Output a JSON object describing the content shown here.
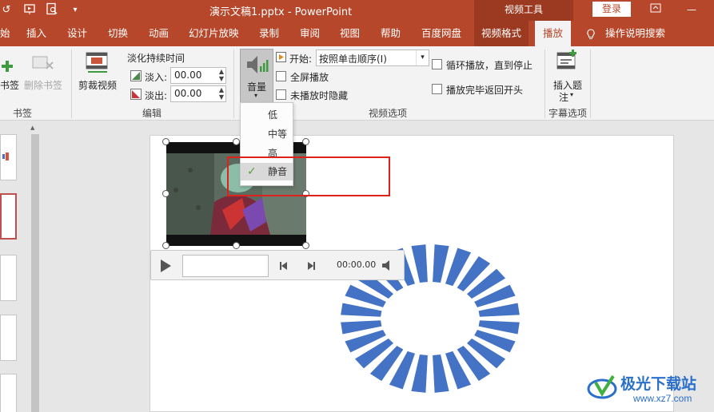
{
  "titlebar": {
    "title": "演示文稿1.pptx  -  PowerPoint",
    "context_tool": "视频工具",
    "login": "登录"
  },
  "tabs": [
    {
      "label": "始"
    },
    {
      "label": "插入"
    },
    {
      "label": "设计"
    },
    {
      "label": "切换"
    },
    {
      "label": "动画"
    },
    {
      "label": "幻灯片放映"
    },
    {
      "label": "录制"
    },
    {
      "label": "审阅"
    },
    {
      "label": "视图"
    },
    {
      "label": "帮助"
    },
    {
      "label": "百度网盘"
    },
    {
      "label": "视频格式"
    },
    {
      "label": "播放"
    }
  ],
  "tell_me": "操作说明搜索",
  "ribbon": {
    "bookmark": {
      "add": "书签",
      "remove": "删除书签",
      "group": "书签"
    },
    "edit": {
      "trim": "剪裁视频",
      "fade_title": "淡化持续时间",
      "fade_in_label": "淡入:",
      "fade_in_value": "00.00",
      "fade_out_label": "淡出:",
      "fade_out_value": "00.00",
      "group": "编辑"
    },
    "video_options": {
      "volume": "音量",
      "start_label": "开始:",
      "start_value": "按照单击顺序(I)",
      "fullscreen": "全屏播放",
      "hide_not_playing": "未播放时隐藏",
      "loop": "循环播放，直到停止",
      "rewind": "播放完毕返回开头",
      "group": "视频选项"
    },
    "captions": {
      "insert_line1": "插入题",
      "insert_line2": "注",
      "group": "字幕选项"
    }
  },
  "volume_menu": {
    "items": [
      {
        "label": "低"
      },
      {
        "label": "中等"
      },
      {
        "label": "高"
      },
      {
        "label": "静音"
      }
    ],
    "selected": "静音"
  },
  "player": {
    "time": "00:00.00"
  },
  "watermark": {
    "text": "极光下载站",
    "url": "www.xz7.com"
  },
  "colors": {
    "accent": "#b7472a",
    "shape_blue": "#4472c4",
    "highlight": "#e0201b"
  }
}
